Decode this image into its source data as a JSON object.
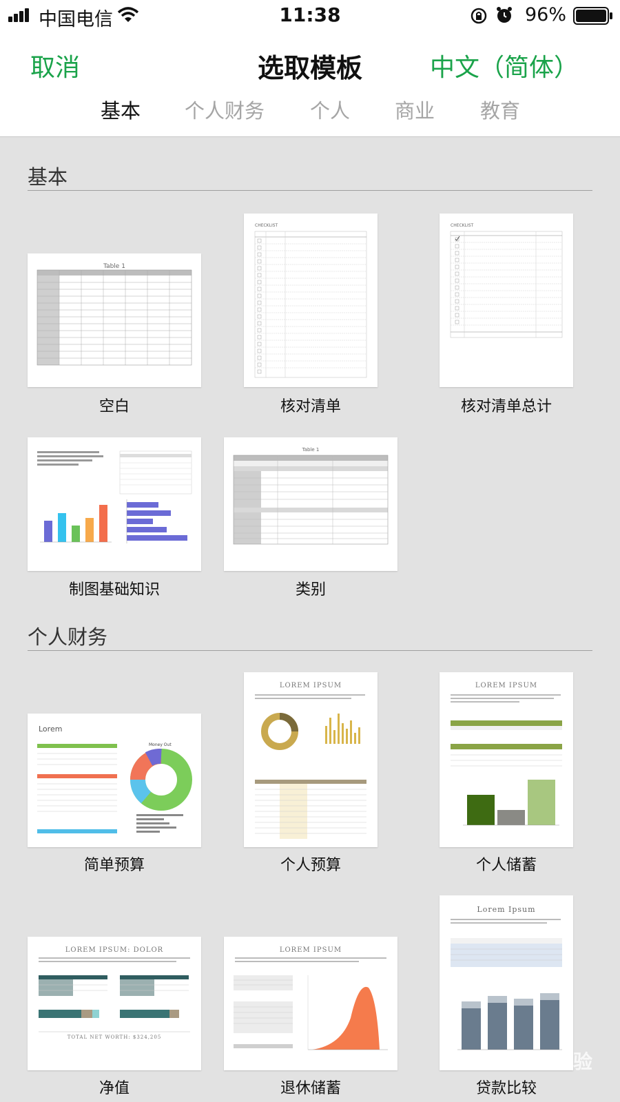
{
  "status_bar": {
    "carrier": "中国电信",
    "time": "11:38",
    "battery": "96%"
  },
  "header": {
    "cancel": "取消",
    "title": "选取模板",
    "language": "中文（简体）"
  },
  "tabs": [
    "基本",
    "个人财务",
    "个人",
    "商业",
    "教育"
  ],
  "selected_tab": "基本",
  "sections": [
    {
      "title": "基本",
      "templates": [
        "空白",
        "核对清单",
        "核对清单总计",
        "制图基础知识",
        "类别"
      ]
    },
    {
      "title": "个人财务",
      "templates": [
        "简单预算",
        "个人预算",
        "个人储蓄",
        "净值",
        "退休储蓄",
        "贷款比较"
      ]
    }
  ],
  "thumbnails": {
    "blank_title": "Table 1",
    "checklist_title": "CHECKLIST",
    "categories_title": "Table 1",
    "budget_brand": "Lorem",
    "budget_chart_title": "Money Out",
    "lorem": "LOREM IPSUM",
    "lorem_dolor": "LOREM IPSUM: DOLOR",
    "lorem_serif": "Lorem Ipsum",
    "net_worth_total": "TOTAL NET WORTH: $324,205"
  },
  "watermark": "Baidu 经验"
}
